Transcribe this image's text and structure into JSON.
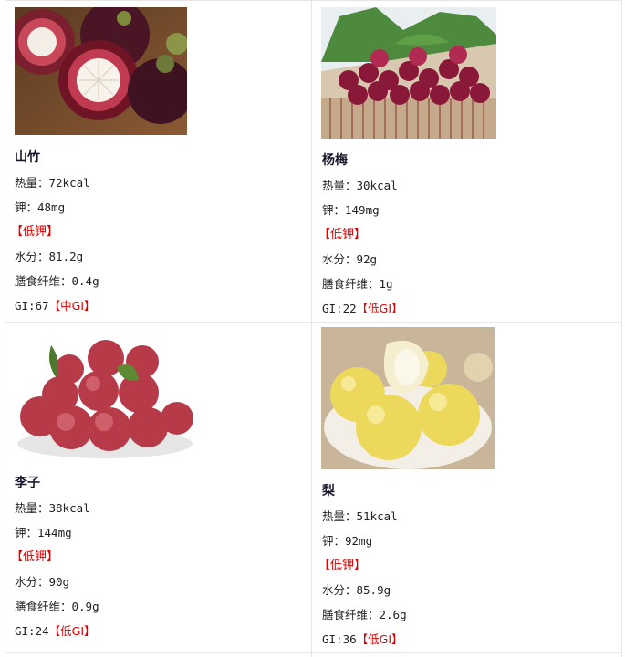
{
  "fruits": [
    {
      "name": "山竹",
      "calories": "热量：72kcal",
      "potassium": "钾：48mg",
      "potassium_tag": "【低钾】",
      "water": "水分：81.2g",
      "fiber": "膳食纤维：0.4g",
      "gi": "GI:67",
      "gi_tag": "【中GI】",
      "image": "mangosteen-photo"
    },
    {
      "name": "杨梅",
      "calories": "热量：30kcal",
      "potassium": "钾：149mg",
      "potassium_tag": "【低钾】",
      "water": "水分：92g",
      "fiber": "膳食纤维：1g",
      "gi": "GI:22",
      "gi_tag": "【低GI】",
      "image": "bayberry-photo"
    },
    {
      "name": "李子",
      "calories": "热量：38kcal",
      "potassium": "钾：144mg",
      "potassium_tag": "【低钾】",
      "water": "水分：90g",
      "fiber": "膳食纤维：0.9g",
      "gi": "GI:24",
      "gi_tag": "【低GI】",
      "image": "plum-photo"
    },
    {
      "name": "梨",
      "calories": "热量：51kcal",
      "potassium": "钾：92mg",
      "potassium_tag": "【低钾】",
      "water": "水分：85.9g",
      "fiber": "膳食纤维：2.6g",
      "gi": "GI:36",
      "gi_tag": "【低GI】",
      "image": "pear-photo"
    }
  ],
  "colors": {
    "tag": "#e00000",
    "border": "#e6e6e6"
  }
}
